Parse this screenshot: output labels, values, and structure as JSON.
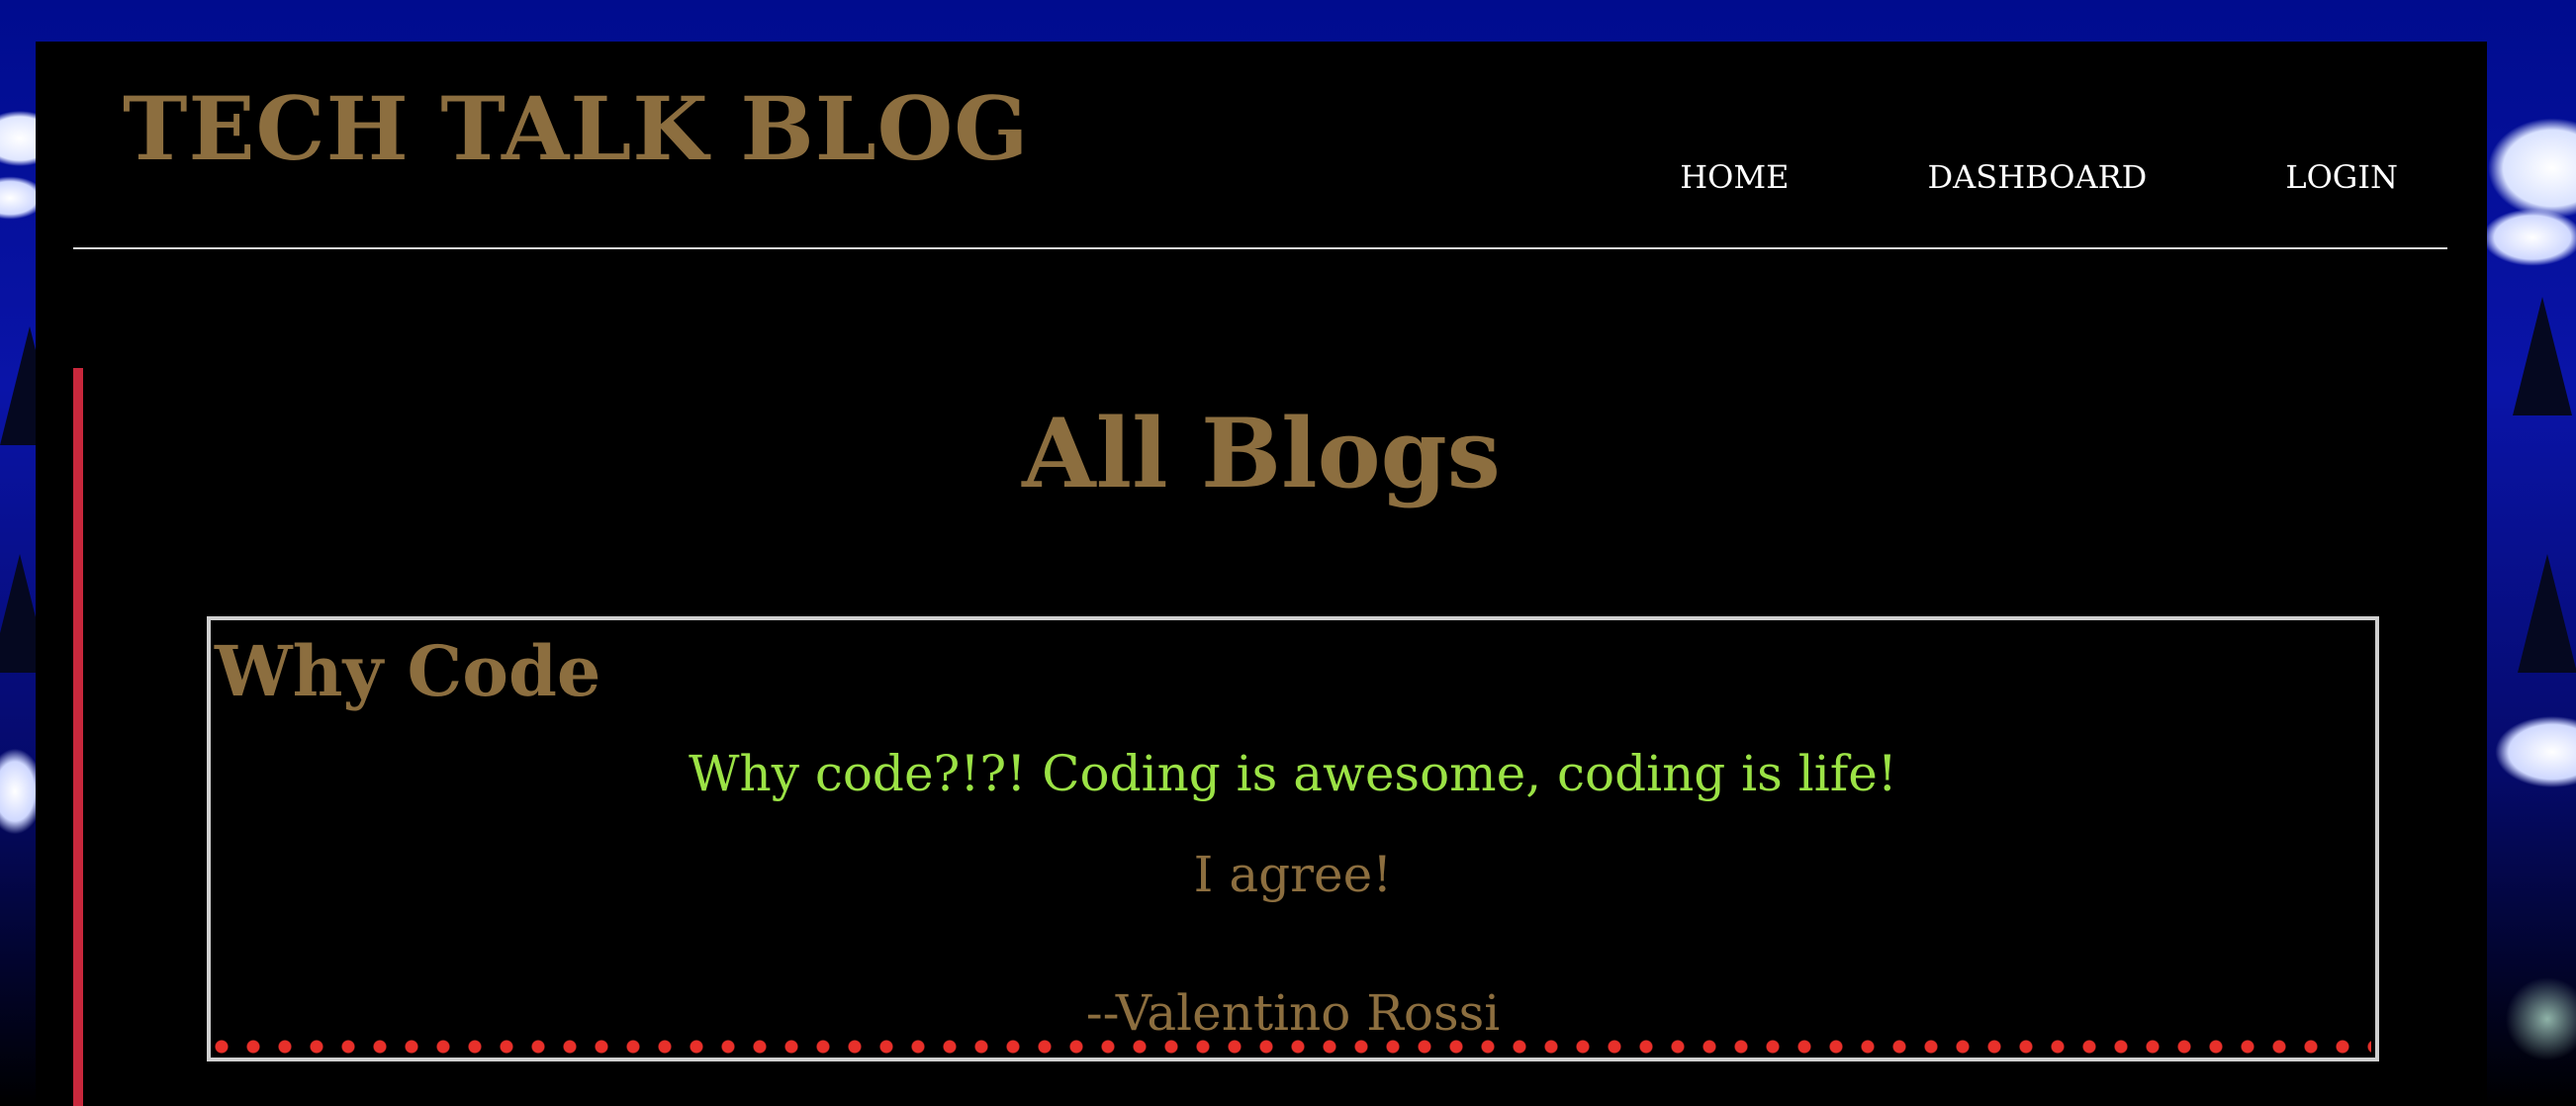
{
  "site": {
    "title": "TECH TALK BLOG"
  },
  "nav": {
    "items": [
      {
        "label": "HOME"
      },
      {
        "label": "DASHBOARD"
      },
      {
        "label": "LOGIN"
      }
    ]
  },
  "main": {
    "heading": "All Blogs",
    "posts": [
      {
        "title": "Why Code",
        "body": "Why code?!?! Coding is awesome, coding is life!",
        "comment": {
          "text": "I agree!",
          "author": "--Valentino Rossi"
        }
      }
    ]
  },
  "colors": {
    "accent_gold": "#8c6e3f",
    "post_text_green": "#9be245",
    "sidebar_red": "#c8283c",
    "dot_red": "#e8302a",
    "background_blue": "#0a0f8c"
  }
}
